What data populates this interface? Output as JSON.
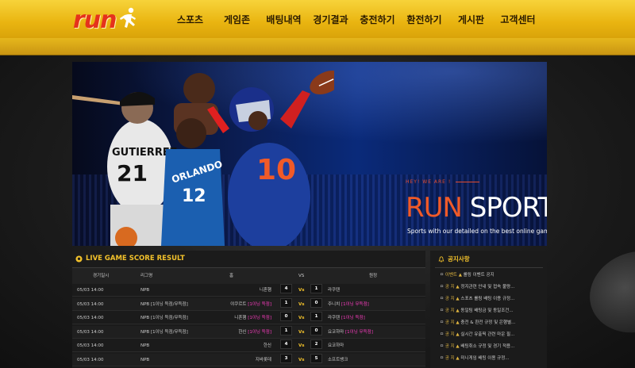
{
  "header": {
    "logo_text": "run",
    "nav": [
      "스포츠",
      "게임존",
      "배팅내역",
      "경기결과",
      "충전하기",
      "환전하기",
      "게시판",
      "고객센터"
    ]
  },
  "banner": {
    "hey": "HEY! WE ARE !",
    "brand_run": "RUN",
    "brand_sports": " SPORTS",
    "tagline": "Sports with our detailed  on the best online gambling sites RUN."
  },
  "live": {
    "title": "LIVE GAME SCORE RESULT",
    "headers": {
      "time": "경기일시",
      "league": "리그명",
      "home": "홈",
      "vs": "VS",
      "away": "원정"
    },
    "rows": [
      {
        "time": "05/03 14:00",
        "league": "NPB",
        "home": "니혼햄",
        "home_tag": "",
        "hs": "4",
        "vs": "Vs",
        "as": "1",
        "away": "라쿠텐",
        "away_tag": ""
      },
      {
        "time": "05/03 14:00",
        "league": "NPB [1이닝 득점/무득점]",
        "home": "야쿠르트",
        "home_tag": "[1이닝 득점]",
        "hs": "1",
        "vs": "Vs",
        "as": "0",
        "away": "주니치",
        "away_tag": "[1이닝 무득점]"
      },
      {
        "time": "05/03 14:00",
        "league": "NPB [1이닝 득점/무득점]",
        "home": "니혼햄",
        "home_tag": "[1이닝 득점]",
        "hs": "0",
        "vs": "Vs",
        "as": "1",
        "away": "라쿠텐",
        "away_tag": "[1이닝 득점]"
      },
      {
        "time": "05/03 14:00",
        "league": "NPB [1이닝 득점/무득점]",
        "home": "한신",
        "home_tag": "[1이닝 득점]",
        "hs": "1",
        "vs": "Vs",
        "as": "0",
        "away": "요코하마",
        "away_tag": "[1이닝 무득점]"
      },
      {
        "time": "05/03 14:00",
        "league": "NPB",
        "home": "한신",
        "home_tag": "",
        "hs": "4",
        "vs": "Vs",
        "as": "2",
        "away": "요코하마",
        "away_tag": ""
      },
      {
        "time": "05/03 14:00",
        "league": "NPB",
        "home": "지바롯데",
        "home_tag": "",
        "hs": "3",
        "vs": "Vs",
        "as": "5",
        "away": "소프트뱅크",
        "away_tag": ""
      }
    ]
  },
  "notice": {
    "title": "공지사항",
    "items": [
      {
        "tag": "이벤트 ▲",
        "text": "롤링 이벤트 공지"
      },
      {
        "tag": "공 지 ▲",
        "text": "정지관련 안내 및 접속 불량..."
      },
      {
        "tag": "공 지 ▲",
        "text": "스포츠 롤링 배팅 이용 규정..."
      },
      {
        "tag": "공 지 ▲",
        "text": "동일팀 배팅금 및 동일조건..."
      },
      {
        "tag": "공 지 ▲",
        "text": "충전 & 환전 규정 및 은행별..."
      },
      {
        "tag": "공 지 ▲",
        "text": "실시간 유출픽 관련 마운 필..."
      },
      {
        "tag": "공 지 ▲",
        "text": "배팅취소 규정 및 경기 적용..."
      },
      {
        "tag": "공 지 ▲",
        "text": "미니게임 배팅 이용 규정..."
      }
    ]
  },
  "colors": {
    "header_yellow": "#e9b410",
    "accent": "#f2c12b",
    "brand_red": "#e5321c",
    "pink": "#ff3dc3"
  }
}
